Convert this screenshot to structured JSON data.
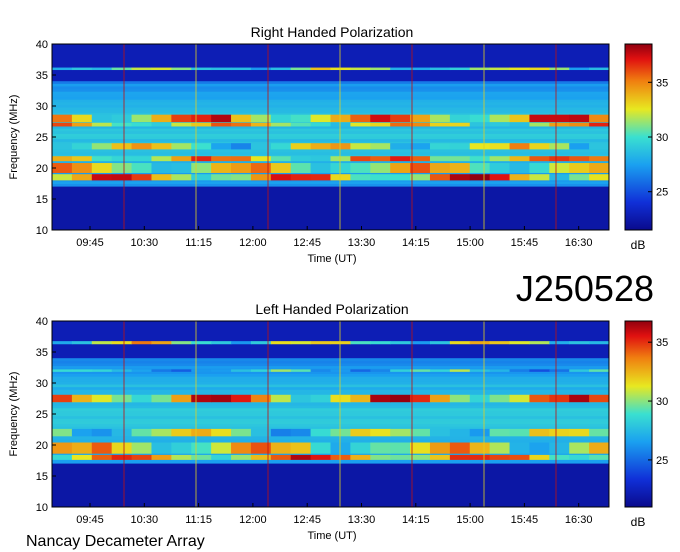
{
  "page": {
    "id_label": "J250528",
    "footer": "Nancay Decameter Array"
  },
  "colors": {
    "background_low": "#10107a",
    "mid": "#1e7ee8",
    "high": "#e8e81e",
    "peak": "#a00010"
  },
  "chart_data": [
    {
      "type": "heatmap",
      "title": "Right Handed Polarization",
      "xlabel": "Time (UT)",
      "ylabel": "Frequency (MHz)",
      "xticks": [
        "09:45",
        "10:30",
        "11:15",
        "12:00",
        "12:45",
        "13:30",
        "14:15",
        "15:00",
        "15:45",
        "16:30"
      ],
      "yticks": [
        10,
        15,
        20,
        25,
        30,
        35,
        40
      ],
      "ylim": [
        10,
        40
      ],
      "colorbar": {
        "label": "dB",
        "ticks": [
          25,
          30,
          35
        ],
        "range": [
          21.5,
          38.5
        ]
      },
      "bands_mhz": [
        {
          "freq": 28.0,
          "width": 1.2,
          "level": 0.95
        },
        {
          "freq": 27.0,
          "width": 0.6,
          "level": 0.85
        },
        {
          "freq": 23.5,
          "width": 1.0,
          "level": 0.75
        },
        {
          "freq": 21.5,
          "width": 0.8,
          "level": 0.9
        },
        {
          "freq": 20.0,
          "width": 1.6,
          "level": 0.8
        },
        {
          "freq": 18.5,
          "width": 1.0,
          "level": 0.95
        },
        {
          "freq": 36.0,
          "width": 0.4,
          "level": 0.7
        }
      ]
    },
    {
      "type": "heatmap",
      "title": "Left Handed Polarization",
      "xlabel": "Time (UT)",
      "ylabel": "Frequency (MHz)",
      "xticks": [
        "09:45",
        "10:30",
        "11:15",
        "12:00",
        "12:45",
        "13:30",
        "14:15",
        "15:00",
        "15:45",
        "16:30"
      ],
      "yticks": [
        10,
        15,
        20,
        25,
        30,
        35,
        40
      ],
      "ylim": [
        10,
        40
      ],
      "colorbar": {
        "label": "dB",
        "ticks": [
          25,
          30,
          35
        ],
        "range": [
          21.0,
          36.8
        ]
      },
      "bands_mhz": [
        {
          "freq": 27.5,
          "width": 1.2,
          "level": 0.95
        },
        {
          "freq": 36.5,
          "width": 0.5,
          "level": 0.75
        },
        {
          "freq": 22.0,
          "width": 1.2,
          "level": 0.7
        },
        {
          "freq": 19.5,
          "width": 1.8,
          "level": 0.8
        },
        {
          "freq": 18.0,
          "width": 0.8,
          "level": 0.95
        },
        {
          "freq": 32.0,
          "width": 0.4,
          "level": 0.55
        }
      ]
    }
  ]
}
